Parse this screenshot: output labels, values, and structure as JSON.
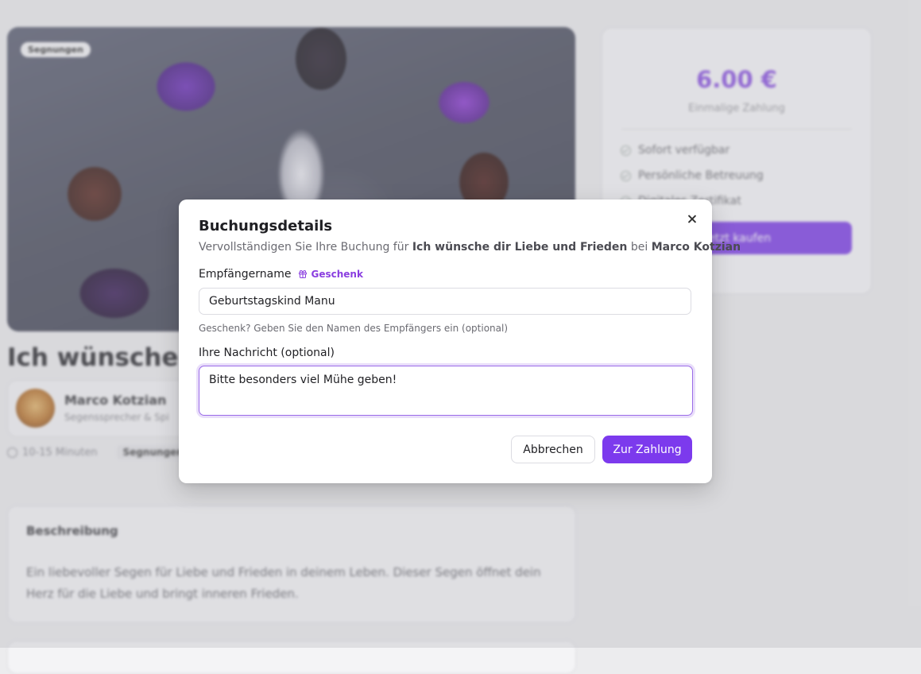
{
  "background": {
    "hero_badge": "Segnungen",
    "title": "Ich wünsche dir Liebe und Frieden",
    "author": {
      "name": "Marco Kotzian",
      "role": "Segenssprecher & Spi"
    },
    "meta": {
      "duration": "10-15 Minuten",
      "tag": "Segnungen"
    },
    "description": {
      "heading": "Beschreibung",
      "text": "Ein liebevoller Segen für Liebe und Frieden in deinem Leben. Dieser Segen öffnet dein Herz für die Liebe und bringt inneren Frieden."
    },
    "price_card": {
      "price": "6.00 €",
      "price_note": "Einmalige Zahlung",
      "features": [
        "Sofort verfügbar",
        "Persönliche Betreuung",
        "Digitales Zertifikat"
      ],
      "buy_button": "Jetzt kaufen"
    }
  },
  "modal": {
    "title": "Buchungsdetails",
    "subtitle_prefix": "Vervollständigen Sie Ihre Buchung für ",
    "subtitle_service": "Ich wünsche dir Liebe und Frieden",
    "subtitle_mid": " bei ",
    "subtitle_author": "Marco Kotzian",
    "recipient_label": "Empfängername",
    "gift_label": "Geschenk",
    "recipient_value": "Geburtstagskind Manu",
    "recipient_hint": "Geschenk? Geben Sie den Namen des Empfängers ein (optional)",
    "message_label": "Ihre Nachricht (optional)",
    "message_value": "Bitte besonders viel Mühe geben!",
    "cancel_button": "Abbrechen",
    "pay_button": "Zur Zahlung"
  },
  "colors": {
    "accent": "#7c3aed",
    "price": "#8a52e0"
  },
  "icons": {
    "close": "close-icon",
    "gift": "gift-icon",
    "clock": "clock-icon",
    "check": "check-circle-icon"
  }
}
